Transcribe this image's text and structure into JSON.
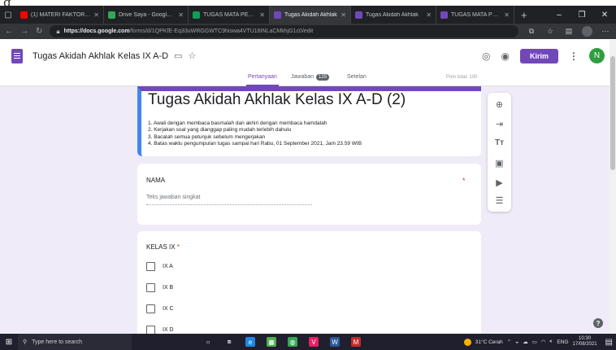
{
  "crop_fragment": "g",
  "browser": {
    "tabs": [
      {
        "label": "(1) MATERI FAKTOR KI",
        "favicon_color": "#ff0000",
        "active": false
      },
      {
        "label": "Drive Saya - Google D",
        "favicon_color": "#34a853",
        "active": false
      },
      {
        "label": "TUGAS MATA PELAJA",
        "favicon_color": "#0f9d58",
        "active": false
      },
      {
        "label": "Tugas Akidah Akhlak",
        "favicon_color": "#7248b9",
        "active": true
      },
      {
        "label": "Tugas Akidah Akhlak",
        "favicon_color": "#7248b9",
        "active": false
      },
      {
        "label": "TUGAS MATA PELAJA",
        "favicon_color": "#7248b9",
        "active": false
      }
    ],
    "url_host": "https://docs.google.com",
    "url_path": "/forms/d/1QPKfE-Eq33uWRGGWTC9hiswa4VTU18INLaCMkhjG1c0/edit"
  },
  "form_header": {
    "title": "Tugas Akidah Akhlak Kelas IX A-D",
    "send_label": "Kirim",
    "avatar_letter": "N"
  },
  "subtabs": {
    "questions": "Pertanyaan",
    "responses": "Jawaban",
    "responses_count": "125",
    "settings": "Setelan",
    "points": "Poin total: 100"
  },
  "form": {
    "title": "Tugas Akidah Akhlak Kelas IX A-D (2)",
    "description": [
      "1. Awali dengan membaca basmalah dan akhiri dengan membaca hamdalah",
      "2. Kerjakan soal yang dianggap paling mudah terlebih dahulu",
      "3. Bacalah semua petunjuk sebelum mengerjakan",
      "4. Batas waktu pengumpulan tugas sampai hari Rabu, 01 September 2021, Jam 23.59 WIB"
    ],
    "q1_label": "NAMA",
    "q1_required": "*",
    "q1_placeholder": "Teks jawaban singkat",
    "q2_label": "KELAS IX",
    "q2_required": "*",
    "q2_options": [
      "IX A",
      "IX B",
      "IX C",
      "IX D"
    ]
  },
  "taskbar": {
    "search_placeholder": "Type here to search",
    "weather": "31°C  Cerah",
    "language": "ENG",
    "time": "10:30",
    "date": "17/08/2021"
  }
}
